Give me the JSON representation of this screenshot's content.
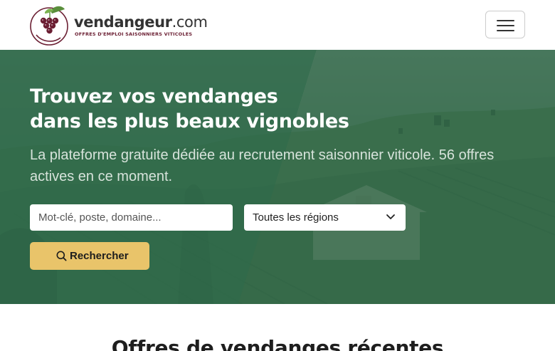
{
  "brand": {
    "name": "vendangeur",
    "domain_suffix": ".com",
    "tagline": "OFFRES D'EMPLOI SAISONNIERS VITICOLES",
    "colors": {
      "grape": "#6b1f33",
      "leaf": "#5a8f3c",
      "text": "#333333"
    }
  },
  "nav": {
    "menu_icon": "hamburger-menu-icon"
  },
  "hero": {
    "title_line1": "Trouvez vos vendanges",
    "title_line2": "dans les plus beaux vignobles",
    "subtitle": "La plateforme gratuite dédiée au recrutement saisonnier viticole. 56 offres actives en ce moment.",
    "overlay_color": "#2e6a4a",
    "search": {
      "keyword_placeholder": "Mot-clé, poste, domaine...",
      "keyword_value": "",
      "region_selected": "Toutes les régions",
      "button_label": "Rechercher",
      "button_color": "#e9c46a",
      "button_icon": "search-icon",
      "region_icon": "chevron-down-icon"
    }
  },
  "offers_section": {
    "title": "Offres de vendanges récentes"
  }
}
